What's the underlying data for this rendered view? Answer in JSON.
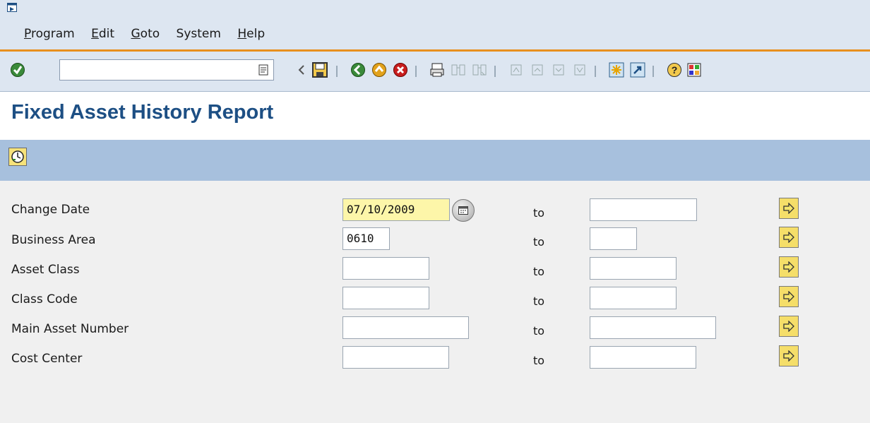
{
  "menu": {
    "items": [
      {
        "first": "P",
        "rest": "rogram"
      },
      {
        "first": "E",
        "rest": "dit"
      },
      {
        "first": "G",
        "rest": "oto"
      },
      {
        "first": "",
        "rest": "System"
      },
      {
        "first": "H",
        "rest": "elp"
      }
    ]
  },
  "toolbar": {
    "command_value": "",
    "icons": [
      "enter-icon",
      "save-icon",
      "back-icon",
      "exit-icon",
      "cancel-icon",
      "print-icon",
      "find-icon",
      "find-next-icon",
      "first-page-icon",
      "previous-page-icon",
      "next-page-icon",
      "last-page-icon",
      "create-session-icon",
      "shortcut-icon",
      "help-icon",
      "customize-layout-icon"
    ]
  },
  "page": {
    "title": "Fixed Asset History Report"
  },
  "selection": {
    "to_label": "to",
    "rows": [
      {
        "label": "Change Date",
        "low": "07/10/2009",
        "high": ""
      },
      {
        "label": "Business Area",
        "low": "0610",
        "high": ""
      },
      {
        "label": "Asset Class",
        "low": "",
        "high": ""
      },
      {
        "label": "Class Code",
        "low": "",
        "high": ""
      },
      {
        "label": "Main Asset Number",
        "low": "",
        "high": ""
      },
      {
        "label": "Cost Center",
        "low": "",
        "high": ""
      }
    ]
  },
  "colors": {
    "title": "#1d4f84",
    "menubar": "#dde6f1",
    "accent_line": "#e8901e",
    "app_toolbar": "#a7c0dd",
    "active_field": "#fdf6a9",
    "multi_select_button": "#f5de69"
  }
}
